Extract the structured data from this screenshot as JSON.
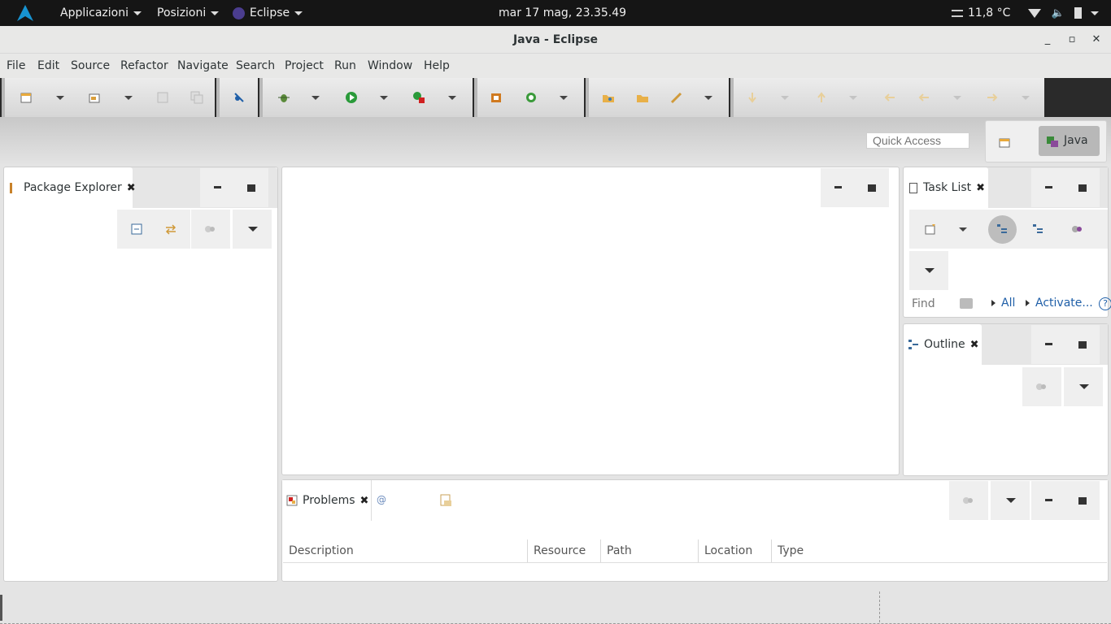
{
  "topbar": {
    "applications": "Applicazioni",
    "places": "Posizioni",
    "app": "Eclipse",
    "clock": "mar 17 mag, 23.35.49",
    "weather": "11,8 °C"
  },
  "window": {
    "title": "Java - Eclipse"
  },
  "menu": [
    "File",
    "Edit",
    "Source",
    "Refactor",
    "Navigate",
    "Search",
    "Project",
    "Run",
    "Window",
    "Help"
  ],
  "quick_access": {
    "placeholder": "Quick Access"
  },
  "perspective": {
    "java_label": "Java"
  },
  "package_explorer": {
    "tab_label": "Package Explorer"
  },
  "task_list": {
    "tab_label": "Task List",
    "find_placeholder": "Find",
    "all_label": "All",
    "activate_label": "Activate..."
  },
  "outline": {
    "tab_label": "Outline"
  },
  "problems": {
    "tab_label": "Problems",
    "columns": [
      "Description",
      "Resource",
      "Path",
      "Location",
      "Type"
    ]
  },
  "colors": {
    "accent": "#1f5fa8",
    "topbar": "#151515",
    "toolbar_bg": "#2a2a2a"
  }
}
